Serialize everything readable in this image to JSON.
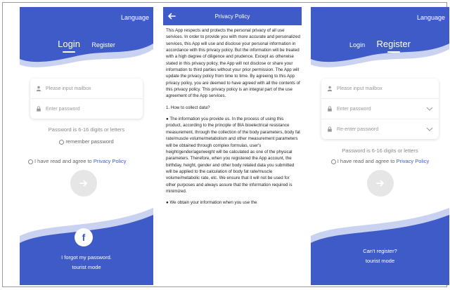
{
  "login": {
    "language": "Language",
    "tab_login": "Login",
    "tab_register": "Register",
    "mail_placeholder": "Please input mailbox",
    "password_placeholder": "Enter password",
    "password_hint": "Password is 6-16 digits or letters",
    "remember": "remember password",
    "agree_prefix": "I have read and agree to",
    "agree_link": "Privacy Policy",
    "forgot": "I forgot my password.",
    "tourist": "tourist mode",
    "facebook_letter": "f"
  },
  "privacy": {
    "title": "Privacy Policy",
    "intro": "This App respects and protects the personal privacy of all use services. In order to provide you with more accurate and personalized services, this App will use and disclose your personal information in accordance with this privacy policy. But the information will be treated with a high degree of diligence and prudence. Except as otherwise stated in this privacy policy, the App will not disclose or share your information to third parties without your prior permission. The App will update the privacy policy from time to time. By agreeing to this App privacy policy, you are deemed to have agreed with all the contents of this privacy policy. This privacy policy is an integral part of the use agreement of the App services.",
    "section1": "1. How to collect data?",
    "bullet1": "● The information you provide us. In the process of using this product, according to the principle of BIA bioelectrical resistance measurement, through the collection of the body parameters, body fat rate/muscle volume/metabolism and other measurement parameters will be obtained through complex formulas, user's height/gender/age/weight will be calculated as one of the physical parameters. Therefore, when you registered the App account, the birthday, height, gender and other body related data you submitted will be applied to the calculation of body fat rate/muscle volume/metabolic rate, etc. We ensure that it will not be used for other purposes and always assure that the information required is minimized.",
    "bullet2": "● We obtain your information when you use the"
  },
  "register": {
    "language": "Language",
    "tab_login": "Login",
    "tab_register": "Register",
    "mail_placeholder": "Please input mailbox",
    "password_placeholder": "Enter password",
    "reenter_placeholder": "Re-enter password",
    "password_hint": "Password is 6-16 digits or letters",
    "agree_prefix": "I have read and agree to",
    "agree_link": "Privacy Policy",
    "cant_register": "Can't register?",
    "tourist": "tourist mode"
  },
  "colors": {
    "brand_blue": "#3f5bc8",
    "wave_light": "#c9d2f1",
    "link": "#3a5bd9",
    "button_gray": "#e6e6e6"
  }
}
